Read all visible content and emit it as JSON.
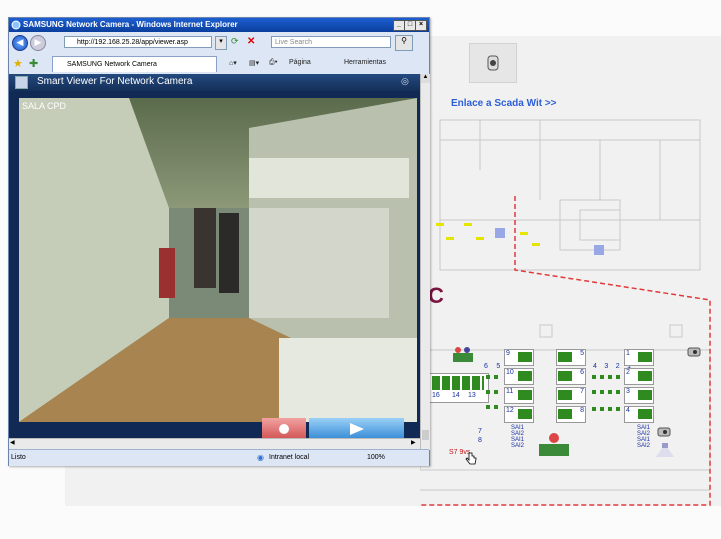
{
  "browser": {
    "title": "SAMSUNG Network Camera - Windows Internet Explorer",
    "address": "http://192.168.25.28/app/viewer.asp",
    "search_placeholder": "Live Search",
    "tab_label": "SAMSUNG Network Camera",
    "cmd_page": "Página",
    "cmd_tools": "Herramientas",
    "viewer_title": "Smart Viewer For Network Camera",
    "camera_name": "SALA CPD",
    "status_left": "Listo",
    "status_zone": "Intranet local",
    "status_zoom": "100%"
  },
  "scada": {
    "link": "Enlace a Scada Wit >>",
    "room_letter": "C",
    "sai_left": [
      "SAI1",
      "SAI2",
      "SAI1",
      "SAI2"
    ],
    "sai_right": [
      "SAI1",
      "SAI2",
      "SAI1",
      "SAI2"
    ],
    "rack_nums_a": [
      "6",
      "5"
    ],
    "rack_nums_b": [
      "4",
      "3",
      "2",
      "1"
    ],
    "rack_ids_left": [
      "9",
      "10",
      "11",
      "12"
    ],
    "rack_ids_mid": [
      "5",
      "6",
      "7",
      "8"
    ],
    "rack_ids_right": [
      "1",
      "2",
      "3",
      "4"
    ],
    "rack_bottom": [
      "16",
      "14",
      "13"
    ],
    "dot_nums": [
      "7",
      "8"
    ],
    "s7_label": "S7 9vs",
    "colors": {
      "rack_green": "#2f8a1f",
      "dashed_border": "#e03a3a",
      "link": "#2c5fd6"
    }
  }
}
